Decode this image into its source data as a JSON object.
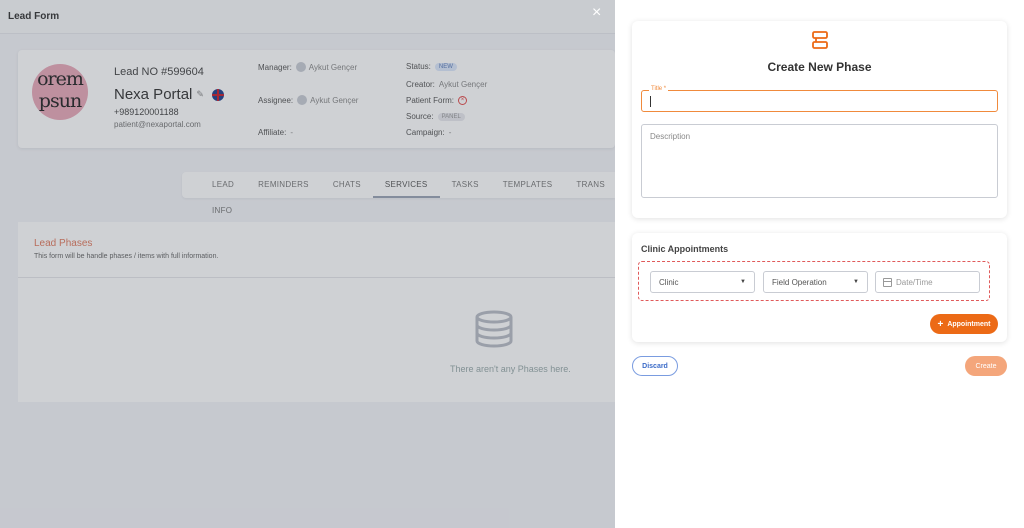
{
  "background": {
    "header_title": "Lead Form",
    "close_glyph": "×",
    "lead": {
      "avatar_text": "orem\npsun",
      "number": "Lead NO #599604",
      "name": "Nexa Portal",
      "phone": "+989120001188",
      "email": "patient@nexaportal.com"
    },
    "meta": {
      "manager_label": "Manager:",
      "manager_value": "Aykut Gençer",
      "assignee_label": "Assignee:",
      "assignee_value": "Aykut Gençer",
      "affiliate_label": "Affiliate:",
      "affiliate_value": "-",
      "status_label": "Status:",
      "status_value": "NEW",
      "creator_label": "Creator:",
      "creator_value": "Aykut Gençer",
      "patient_form_label": "Patient Form:",
      "source_label": "Source:",
      "source_value": "PANEL",
      "campaign_label": "Campaign:",
      "campaign_value": "-"
    },
    "tabs": [
      "LEAD INFO",
      "REMINDERS",
      "CHATS",
      "SERVICES",
      "TASKS",
      "TEMPLATES",
      "TRANS"
    ],
    "active_tab": "SERVICES",
    "phases": {
      "title": "Lead Phases",
      "description": "This form will be handle phases / items with full information.",
      "empty_text": "There aren't any Phases here."
    }
  },
  "panel": {
    "title": "Create New Phase",
    "title_field": {
      "label": "Title *",
      "value": ""
    },
    "description_field": {
      "placeholder": "Description",
      "value": ""
    },
    "appointments": {
      "title": "Clinic Appointments",
      "clinic_select": "Clinic",
      "operation_select": "Field Operation",
      "date_placeholder": "Date/Time",
      "add_button": "Appointment"
    },
    "discard_label": "Discard",
    "create_label": "Create"
  },
  "colors": {
    "accent": "#ec6a16",
    "accent_light": "#f4a67b",
    "link_blue": "#3b6bc8",
    "error_red": "#e05a5a"
  },
  "icons": [
    "close-icon",
    "edit-icon",
    "uk-flag-icon",
    "patient-form-error-icon",
    "database-icon",
    "phase-icon",
    "chevron-down-icon",
    "calendar-icon",
    "plus-icon"
  ]
}
